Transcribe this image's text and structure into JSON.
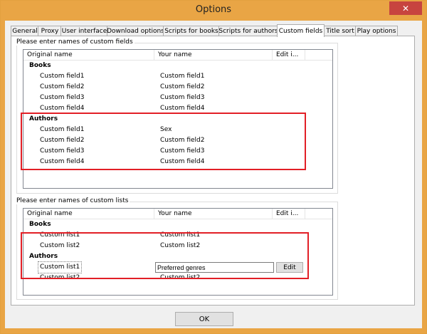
{
  "window": {
    "title": "Options",
    "close_glyph": "✕"
  },
  "tabs": [
    {
      "label": "General"
    },
    {
      "label": "Proxy"
    },
    {
      "label": "User interface"
    },
    {
      "label": "Download options"
    },
    {
      "label": "Scripts for books"
    },
    {
      "label": "Scripts for authors"
    },
    {
      "label": "Custom fields"
    },
    {
      "label": "Title sort"
    },
    {
      "label": "Play options"
    }
  ],
  "fields_group": {
    "legend": "Please enter names of custom fields",
    "columns": [
      "Original name",
      "Your name",
      "Edit i..."
    ],
    "books_title": "Books",
    "books": [
      {
        "original": "Custom field1",
        "yours": "Custom field1"
      },
      {
        "original": "Custom field2",
        "yours": "Custom field2"
      },
      {
        "original": "Custom field3",
        "yours": "Custom field3"
      },
      {
        "original": "Custom field4",
        "yours": "Custom field4"
      }
    ],
    "authors_title": "Authors",
    "authors": [
      {
        "original": "Custom field1",
        "yours": "Sex"
      },
      {
        "original": "Custom field2",
        "yours": "Custom field2"
      },
      {
        "original": "Custom field3",
        "yours": "Custom field3"
      },
      {
        "original": "Custom field4",
        "yours": "Custom field4"
      }
    ]
  },
  "lists_group": {
    "legend": "Please enter names of custom lists",
    "columns": [
      "Original name",
      "Your name",
      "Edit i..."
    ],
    "books_title": "Books",
    "books": [
      {
        "original": "Custom list1",
        "yours": "Custom list1"
      },
      {
        "original": "Custom list2",
        "yours": "Custom list2"
      }
    ],
    "authors_title": "Authors",
    "authors": [
      {
        "original": "Custom list1",
        "yours": "Preferred genres"
      },
      {
        "original": "Custom list2",
        "yours": "Custom list2"
      }
    ],
    "edit_button": "Edit"
  },
  "ok_button": "OK",
  "colors": {
    "titlebar": "#e9a545",
    "close": "#c7443f",
    "highlight": "#e21f26"
  }
}
